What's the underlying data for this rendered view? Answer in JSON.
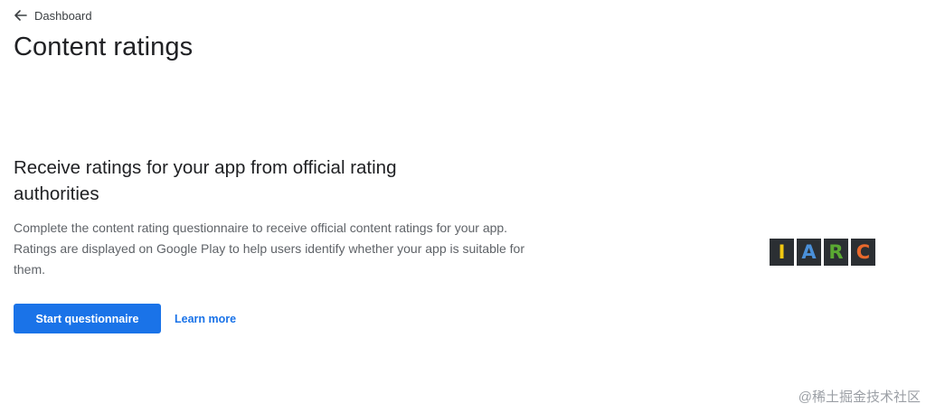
{
  "breadcrumb": {
    "icon": "arrow-back-icon",
    "label": "Dashboard"
  },
  "page": {
    "title": "Content ratings"
  },
  "section": {
    "heading": "Receive ratings for your app from official rating authorities",
    "description": "Complete the content rating questionnaire to receive official content ratings for your app. Ratings are displayed on Google Play to help users identify whether your app is suitable for them."
  },
  "actions": {
    "primary_label": "Start questionnaire",
    "link_label": "Learn more"
  },
  "logo": {
    "name": "IARC",
    "tile_bg": "#2b2f33",
    "letters": [
      {
        "char": "I",
        "color": "#f2c811"
      },
      {
        "char": "A",
        "color": "#4a90d9"
      },
      {
        "char": "R",
        "color": "#5aa832"
      },
      {
        "char": "C",
        "color": "#e8692c"
      }
    ]
  },
  "watermark": "@稀土掘金技术社区",
  "colors": {
    "primary": "#1a73e8",
    "text_primary": "#202124",
    "text_secondary": "#5f6368"
  }
}
